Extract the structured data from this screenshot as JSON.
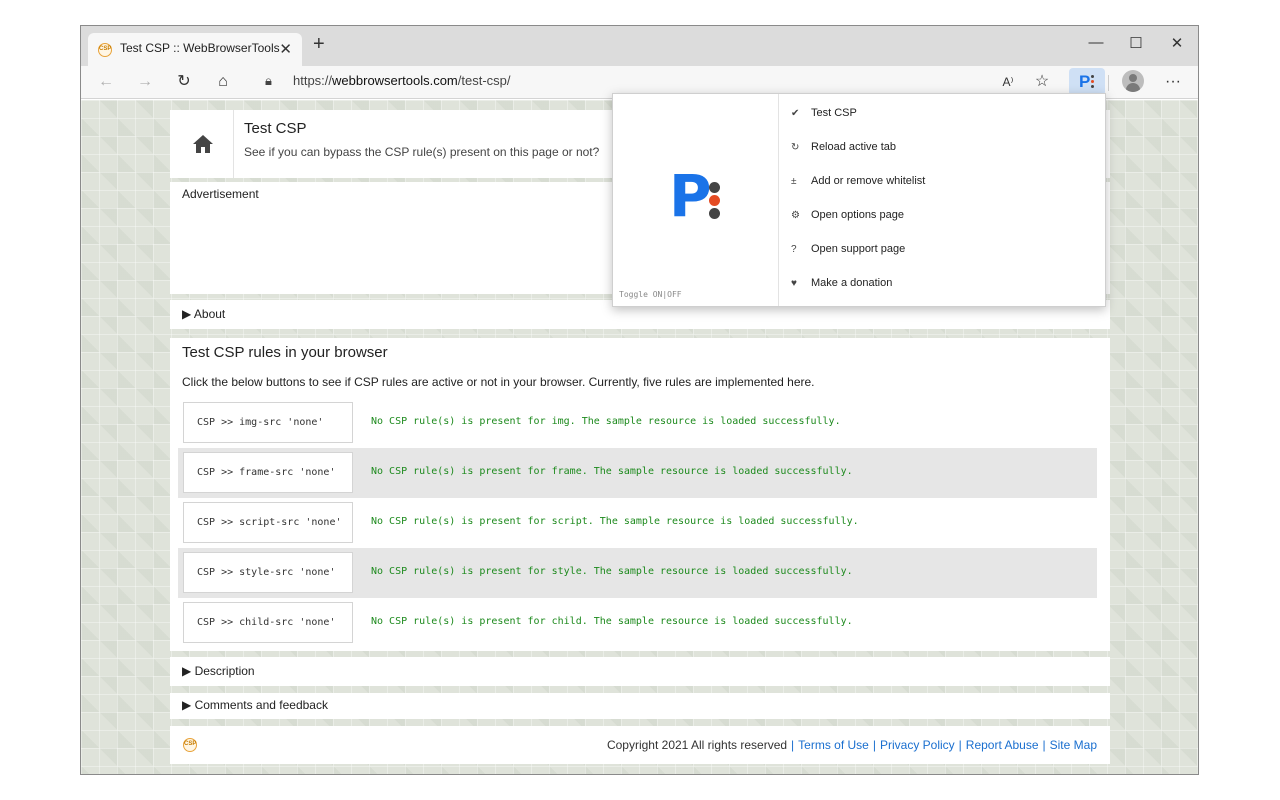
{
  "browser": {
    "tab_title": "Test CSP :: WebBrowserTools",
    "tab_favicon_text": "CSP",
    "tab_close": "✕",
    "new_tab": "+",
    "window_controls": {
      "minimize": "—",
      "maximize": "☐",
      "close": "✕"
    },
    "url_scheme": "https://",
    "url_host": "webbrowsertools.com",
    "url_path": "/test-csp/",
    "icons": [
      "back-icon",
      "forward-icon",
      "refresh-icon",
      "home-icon",
      "lock-icon",
      "read-aloud-icon",
      "favorites-icon",
      "extension-icon",
      "profile-icon",
      "more-icon"
    ],
    "read_aloud": "A⁾",
    "more": "···"
  },
  "page": {
    "title": "Test CSP",
    "subtitle": "See if you can bypass the CSP rule(s) present on this page or not?",
    "advertisement": "Advertisement",
    "about": "About",
    "main_title": "Test CSP rules in your browser",
    "main_desc": "Click the below buttons to see if CSP rules are active or not in your browser. Currently, five rules are implemented here.",
    "rules": [
      {
        "button": "CSP >> img-src 'none'",
        "message": "No CSP rule(s) is present for img. The sample resource is loaded successfully."
      },
      {
        "button": "CSP >> frame-src 'none'",
        "message": "No CSP rule(s) is present for frame. The sample resource is loaded successfully."
      },
      {
        "button": "CSP >> script-src 'none'",
        "message": "No CSP rule(s) is present for script. The sample resource is loaded successfully."
      },
      {
        "button": "CSP >> style-src 'none'",
        "message": "No CSP rule(s) is present for style. The sample resource is loaded successfully."
      },
      {
        "button": "CSP >> child-src 'none'",
        "message": "No CSP rule(s) is present for child. The sample resource is loaded successfully."
      }
    ],
    "description": "Description",
    "comments": "Comments and feedback",
    "footer": {
      "logo_text": "CSP",
      "copyright": "Copyright 2021 All rights reserved",
      "links": [
        "Terms of Use",
        "Privacy Policy",
        "Report Abuse",
        "Site Map"
      ]
    }
  },
  "popup": {
    "toggle": "Toggle ON|OFF",
    "menu": [
      {
        "icon": "✔",
        "label": "Test CSP"
      },
      {
        "icon": "↻",
        "label": "Reload active tab"
      },
      {
        "icon": "±",
        "label": "Add or remove whitelist"
      },
      {
        "icon": "⚙",
        "label": "Open options page"
      },
      {
        "icon": "?",
        "label": "Open support page"
      },
      {
        "icon": "♥",
        "label": "Make a donation"
      }
    ]
  },
  "colors": {
    "accent": "#1a73e8",
    "link": "#1a6fcf",
    "success_text": "#1d8a1d",
    "logo_red_dot": "#e44b23"
  }
}
